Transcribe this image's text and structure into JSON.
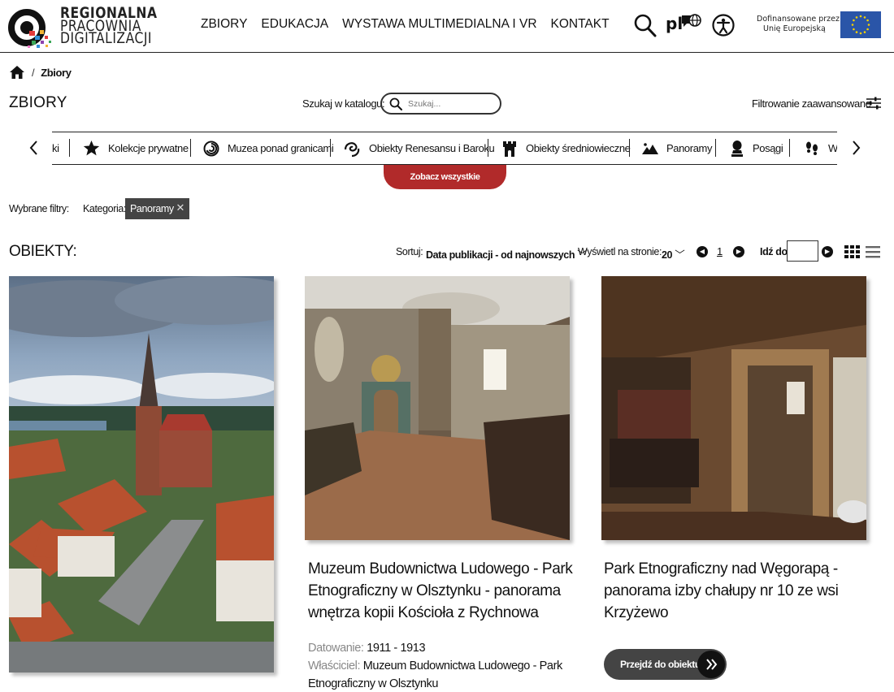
{
  "logo": {
    "line1": "REGIONALNA",
    "line2": "PRACOWNIA",
    "line3": "DIGITALIZACJI"
  },
  "nav": {
    "items": [
      "ZBIORY",
      "EDUKACJA",
      "WYSTAWA MULTIMEDIALNA I VR",
      "KONTAKT"
    ]
  },
  "header": {
    "lang": "pl",
    "eu_line1": "Dofinansowane przez",
    "eu_line2": "Unię Europejską"
  },
  "breadcrumb": {
    "current": "Zbiory"
  },
  "page": {
    "title": "ZBIORY"
  },
  "search": {
    "label": "Szukaj w katalogu:",
    "placeholder": "Szukaj..."
  },
  "advanced_filter": "Filtrowanie zaawansowane",
  "categories": [
    {
      "label": "ki",
      "icon": ""
    },
    {
      "label": "Kolekcje prywatne",
      "icon": "star-icon"
    },
    {
      "label": "Muzea ponad granicami",
      "icon": "spiral-icon"
    },
    {
      "label": "Obiekty Renesansu i Baroku",
      "icon": "swirl-icon"
    },
    {
      "label": "Obiekty średniowieczne",
      "icon": "castle-tower-icon"
    },
    {
      "label": "Panoramy",
      "icon": "landscape-icon"
    },
    {
      "label": "Posągi",
      "icon": "bust-icon"
    },
    {
      "label": "Wi",
      "icon": "footprints-icon"
    }
  ],
  "see_all": "Zobacz wszystkie",
  "filters": {
    "label": "Wybrane filtry:",
    "category_label": "Kategoria:",
    "chip": "Panoramy"
  },
  "objects": {
    "title": "OBIEKTY:",
    "sort_label": "Sortuj:",
    "sort_value": "Data publikacji - od najnowszych",
    "per_page_label": "Wyświetl na stronie:",
    "per_page_value": "20",
    "page": "1",
    "goto_label": "Idź do"
  },
  "cards": [
    {
      "title": ""
    },
    {
      "title": "Muzeum Budownictwa Ludowego - Park Etnograficzny w Olsztynku - panorama wnętrza kopii Kościoła z Rychnowa",
      "dating_label": "Datowanie:",
      "dating": "1911 - 1913",
      "owner_label": "Właściciel:",
      "owner": "Muzeum Budownictwa Ludowego - Park Etnograficzny w Olsztynku"
    },
    {
      "title": "Park Etnograficzny nad Węgorapą - panorama izby chałupy nr 10 ze wsi Krzyżewo",
      "button": "Przejdź do obiektu"
    }
  ],
  "colors": {
    "accent": "#b12a2a",
    "chip": "#444444",
    "eu_blue": "#2a55a8"
  }
}
